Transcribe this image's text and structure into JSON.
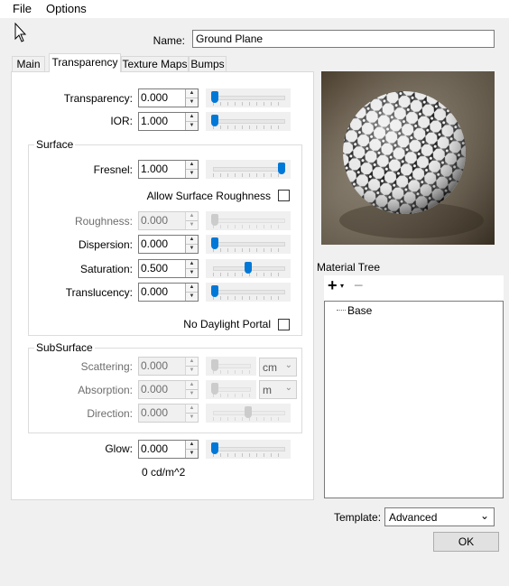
{
  "menu": {
    "file": "File",
    "options": "Options"
  },
  "name": {
    "label": "Name:",
    "value": "Ground Plane"
  },
  "tabs": [
    {
      "label": "Main",
      "active": false
    },
    {
      "label": "Transparency",
      "active": true
    },
    {
      "label": "Texture Maps",
      "active": false
    },
    {
      "label": "Bumps",
      "active": false
    }
  ],
  "transparency": {
    "transparency": {
      "label": "Transparency:",
      "value": "0.000",
      "slider_level": 0.0
    },
    "ior": {
      "label": "IOR:",
      "value": "1.000",
      "slider_level": 0.0
    }
  },
  "surface": {
    "title": "Surface",
    "fresnel": {
      "label": "Fresnel:",
      "value": "1.000",
      "slider_level": 1.0
    },
    "allow_roughness": {
      "label": "Allow Surface Roughness",
      "checked": false
    },
    "roughness": {
      "label": "Roughness:",
      "value": "0.000",
      "slider_level": 0.0,
      "disabled": true
    },
    "dispersion": {
      "label": "Dispersion:",
      "value": "0.000",
      "slider_level": 0.0
    },
    "saturation": {
      "label": "Saturation:",
      "value": "0.500",
      "slider_level": 0.5
    },
    "translucency": {
      "label": "Translucency:",
      "value": "0.000",
      "slider_level": 0.0
    },
    "no_daylight_portal": {
      "label": "No Daylight Portal",
      "checked": false
    }
  },
  "subsurface": {
    "title": "SubSurface",
    "scattering": {
      "label": "Scattering:",
      "value": "0.000",
      "unit": "cm",
      "slider_level": 0.0
    },
    "absorption": {
      "label": "Absorption:",
      "value": "0.000",
      "unit": "m",
      "slider_level": 0.0
    },
    "direction": {
      "label": "Direction:",
      "value": "0.000",
      "slider_level": 0.5
    }
  },
  "glow": {
    "label": "Glow:",
    "value": "0.000",
    "slider_level": 0.0,
    "readout": "0 cd/m^2"
  },
  "material_tree": {
    "title": "Material Tree",
    "add_icon": "plus-icon",
    "remove_icon": "minus-icon",
    "items": [
      "Base"
    ]
  },
  "template": {
    "label": "Template:",
    "value": "Advanced"
  },
  "ok_label": "OK",
  "colors": {
    "accent": "#0078d7",
    "panel_bg": "#ffffff",
    "window_bg": "#f0f0f0"
  }
}
